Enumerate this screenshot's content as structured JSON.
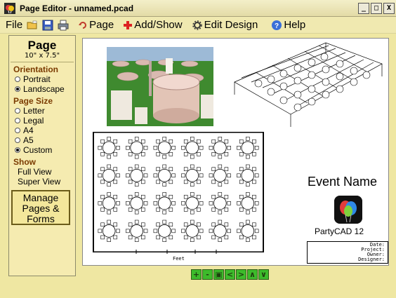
{
  "window": {
    "title": "Page Editor - unnamed.pcad",
    "buttons": [
      "_",
      "□",
      "X"
    ]
  },
  "menubar": {
    "file": "File",
    "page": "Page",
    "add_show": "Add/Show",
    "edit_design": "Edit Design",
    "help": "Help"
  },
  "sidebar": {
    "title": "Page",
    "size": "10\" x 7.5\"",
    "orientation": {
      "header": "Orientation",
      "options": [
        {
          "label": "Portrait",
          "selected": false
        },
        {
          "label": "Landscape",
          "selected": true
        }
      ]
    },
    "page_size": {
      "header": "Page Size",
      "options": [
        {
          "label": "Letter",
          "selected": false
        },
        {
          "label": "Legal",
          "selected": false
        },
        {
          "label": "A4",
          "selected": false
        },
        {
          "label": "A5",
          "selected": false
        },
        {
          "label": "Custom",
          "selected": true
        }
      ]
    },
    "show": {
      "header": "Show",
      "items": [
        "Full View",
        "Super View"
      ]
    },
    "manage_lines": [
      "Manage",
      "Pages &",
      "Forms"
    ]
  },
  "canvas": {
    "event_name": "Event Name",
    "brand": "PartyCAD  12",
    "scale_label": "Feet",
    "info_fields": [
      "Date:",
      "Project:",
      "Owner:",
      "Designer:"
    ]
  },
  "nav": {
    "zoom_in": "+",
    "zoom_out": "-",
    "fit": "▣",
    "left": "<",
    "right": ">",
    "up": "∧",
    "down": "∨"
  },
  "colors": {
    "sidebar_bg": "#f5ebb0",
    "menubar_bg": "#f0e9b0",
    "nav_green": "#3dbb2b"
  }
}
